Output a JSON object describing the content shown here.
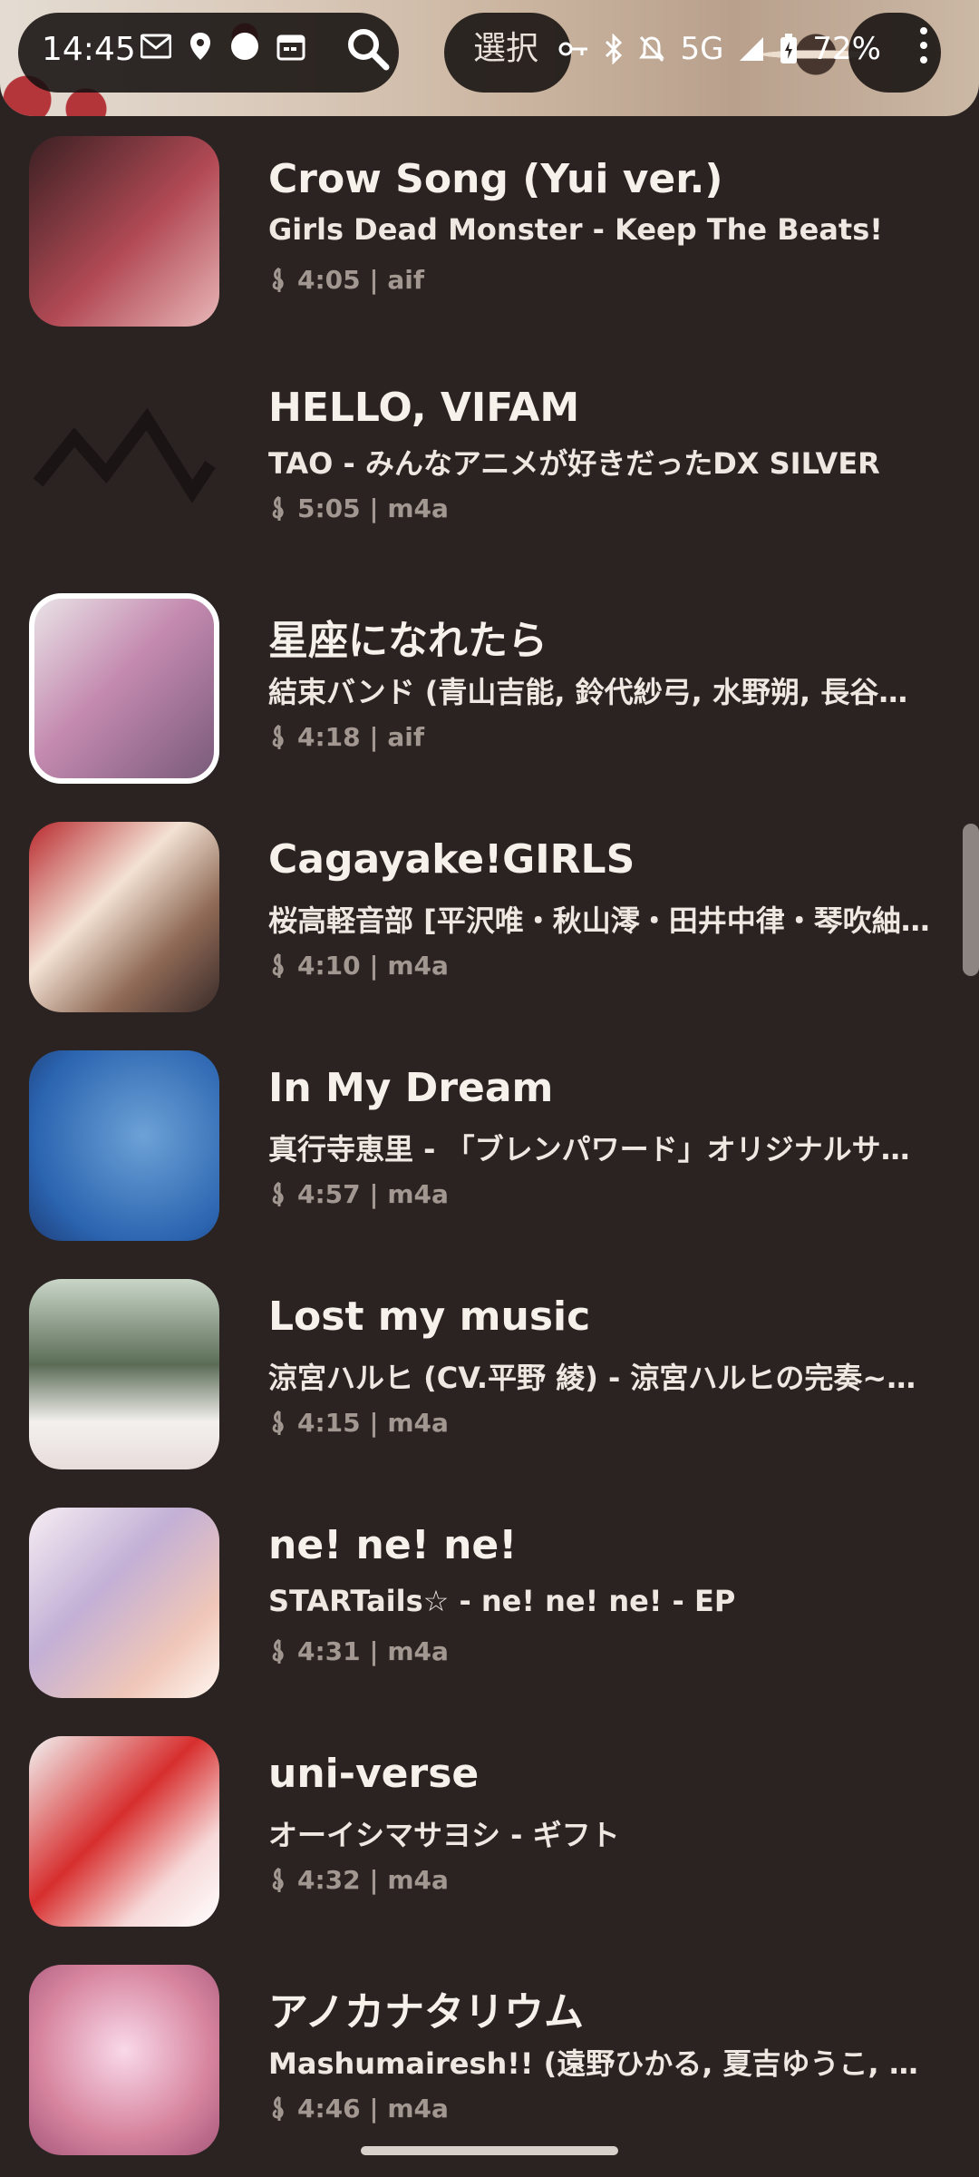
{
  "status_bar": {
    "time": "14:45",
    "select_label": "選択",
    "network": "5G",
    "battery": "72%"
  },
  "colors": {
    "background": "#2a2321",
    "title": "#f7f1ec",
    "meta": "#a39891"
  },
  "tracks": [
    {
      "title": "Crow Song (Yui ver.)",
      "subtitle": "Girls Dead Monster - Keep The Beats!",
      "meta": "4:05 | aif"
    },
    {
      "title": "HELLO, VIFAM",
      "subtitle": "TAO - みんなアニメが好きだったDX SILVER",
      "meta": "5:05 | m4a"
    },
    {
      "title": "星座になれたら",
      "subtitle": "結束バンド (青山吉能, 鈴代紗弓, 水野朔, 長谷川育…",
      "meta": "4:18 | aif"
    },
    {
      "title": "Cagayake!GIRLS",
      "subtitle": "桜高軽音部 [平沢唯・秋山澪・田井中律・琴吹紬(…",
      "meta": "4:10 | m4a"
    },
    {
      "title": "In My Dream",
      "subtitle": "真行寺恵里 - 「ブレンパワード」オリジナルサウ…",
      "meta": "4:57 | m4a"
    },
    {
      "title": "Lost my music",
      "subtitle": "涼宮ハルヒ (CV.平野 綾) - 涼宮ハルヒの完奏~コ …",
      "meta": "4:15 | m4a"
    },
    {
      "title": "ne! ne! ne!",
      "subtitle": "STARTails☆ - ne! ne! ne! - EP",
      "meta": "4:31 | m4a"
    },
    {
      "title": "uni-verse",
      "subtitle": "オーイシマサヨシ - ギフト",
      "meta": "4:32 | m4a"
    },
    {
      "title": "アノカナタリウム",
      "subtitle": "Mashumairesh!! (遠野ひかる, 夏吉ゆうこ, 和多 …",
      "meta": "4:46 | m4a"
    }
  ]
}
